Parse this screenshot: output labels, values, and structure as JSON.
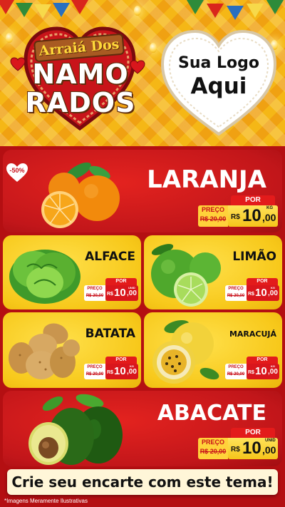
{
  "header": {
    "logo_top": "Arraiá Dos",
    "logo_line1": "NAMO",
    "logo_line2": "RADOS",
    "your_logo_line1": "Sua Logo",
    "your_logo_line2": "Aqui"
  },
  "badge": "-50%",
  "products": [
    {
      "name": "LARANJA",
      "por": "POR",
      "preco_label": "PREÇO",
      "old_price": "R$ 20,00",
      "currency": "R$",
      "price_int": "10",
      "price_cents": ",00",
      "unit": "KG"
    },
    {
      "name": "ALFACE",
      "por": "POR",
      "preco_label": "PREÇO",
      "old_price": "R$ 20,00",
      "currency": "R$",
      "price_int": "10",
      "price_cents": ",00",
      "unit": "UNID"
    },
    {
      "name": "LIMÃO",
      "por": "POR",
      "preco_label": "PREÇO",
      "old_price": "R$ 20,00",
      "currency": "R$",
      "price_int": "10",
      "price_cents": ",00",
      "unit": "KG"
    },
    {
      "name": "BATATA",
      "por": "POR",
      "preco_label": "PREÇO",
      "old_price": "R$ 20,00",
      "currency": "R$",
      "price_int": "10",
      "price_cents": ",00",
      "unit": "KG"
    },
    {
      "name": "MARACUJÁ",
      "por": "POR",
      "preco_label": "PREÇO",
      "old_price": "R$ 20,00",
      "currency": "R$",
      "price_int": "10",
      "price_cents": ",00",
      "unit": "KG"
    },
    {
      "name": "ABACATE",
      "por": "POR",
      "preco_label": "PREÇO",
      "old_price": "R$ 20,00",
      "currency": "R$",
      "price_int": "10",
      "price_cents": ",00",
      "unit": "UNID"
    }
  ],
  "cta": "Crie seu encarte com este tema!",
  "disclaimer": "*Imagens Meramente Ilustrativas",
  "colors": {
    "red": "#c2161a",
    "yellow": "#f7c81a",
    "price_red": "#e31b1b"
  }
}
